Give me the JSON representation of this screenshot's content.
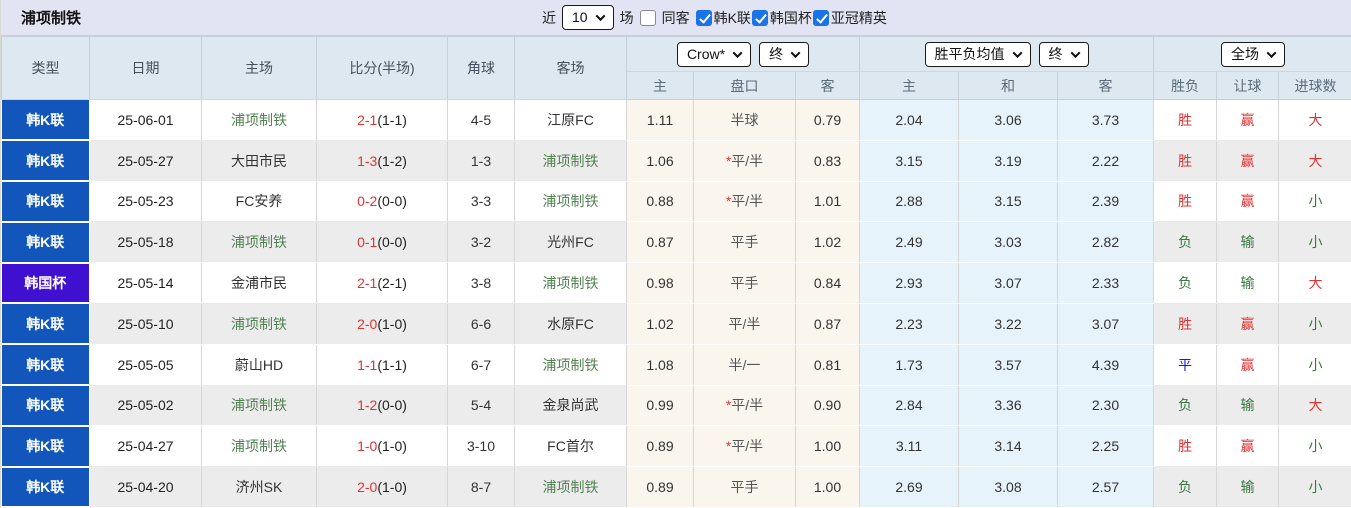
{
  "title": "浦项制铁",
  "toolbar": {
    "recent_label": "近",
    "recent_value": "10",
    "matches_label": "场",
    "same_away": {
      "label": "同客",
      "checked": false,
      "state_class": "unchecked"
    },
    "filters": [
      {
        "label": "韩K联",
        "checked": true,
        "state_class": "checked"
      },
      {
        "label": "韩国杯",
        "checked": true,
        "state_class": "checked"
      },
      {
        "label": "亚冠精英",
        "checked": true,
        "state_class": "checked"
      }
    ]
  },
  "table": {
    "main_headers": [
      "类型",
      "日期",
      "主场",
      "比分(半场)",
      "角球",
      "客场"
    ],
    "odds_group": {
      "bookmaker_select": "Crow*",
      "time_select": "终",
      "cols": [
        "主",
        "盘口",
        "客"
      ]
    },
    "avg_group": {
      "name_select": "胜平负均值",
      "time_select": "终",
      "cols": [
        "主",
        "和",
        "客"
      ]
    },
    "result_group": {
      "scope_select": "全场",
      "cols": [
        "胜负",
        "让球",
        "进球数"
      ]
    },
    "rows": [
      {
        "type": "韩K联",
        "type_class": "league",
        "date": "25-06-01",
        "home": "浦项制铁",
        "home_class": "team-green",
        "score_ft": "2-1",
        "score_ht": "(1-1)",
        "corner": "4-5",
        "away": "江原FC",
        "away_class": "plain",
        "odds_home": "1.11",
        "star": "",
        "handicap": "半球",
        "odds_away": "0.79",
        "avg_home": "2.04",
        "avg_draw": "3.06",
        "avg_away": "3.73",
        "wl": "胜",
        "wl_class": "red",
        "let": "赢",
        "let_class": "red",
        "goal": "大",
        "goal_class": "red"
      },
      {
        "type": "韩K联",
        "type_class": "league",
        "date": "25-05-27",
        "home": "大田市民",
        "home_class": "plain",
        "score_ft": "1-3",
        "score_ht": "(1-2)",
        "corner": "1-3",
        "away": "浦项制铁",
        "away_class": "team-green",
        "odds_home": "1.06",
        "star": "*",
        "handicap": "平/半",
        "odds_away": "0.83",
        "avg_home": "3.15",
        "avg_draw": "3.19",
        "avg_away": "2.22",
        "wl": "胜",
        "wl_class": "red",
        "let": "赢",
        "let_class": "red",
        "goal": "大",
        "goal_class": "red"
      },
      {
        "type": "韩K联",
        "type_class": "league",
        "date": "25-05-23",
        "home": "FC安养",
        "home_class": "plain",
        "score_ft": "0-2",
        "score_ht": "(0-0)",
        "corner": "3-3",
        "away": "浦项制铁",
        "away_class": "team-green",
        "odds_home": "0.88",
        "star": "*",
        "handicap": "平/半",
        "odds_away": "1.01",
        "avg_home": "2.88",
        "avg_draw": "3.15",
        "avg_away": "2.39",
        "wl": "胜",
        "wl_class": "red",
        "let": "赢",
        "let_class": "red",
        "goal": "小",
        "goal_class": "green"
      },
      {
        "type": "韩K联",
        "type_class": "league",
        "date": "25-05-18",
        "home": "浦项制铁",
        "home_class": "team-green",
        "score_ft": "0-1",
        "score_ht": "(0-0)",
        "corner": "3-2",
        "away": "光州FC",
        "away_class": "plain",
        "odds_home": "0.87",
        "star": "",
        "handicap": "平手",
        "odds_away": "1.02",
        "avg_home": "2.49",
        "avg_draw": "3.03",
        "avg_away": "2.82",
        "wl": "负",
        "wl_class": "green",
        "let": "输",
        "let_class": "green",
        "goal": "小",
        "goal_class": "green"
      },
      {
        "type": "韩国杯",
        "type_class": "cup",
        "date": "25-05-14",
        "home": "金浦市民",
        "home_class": "plain",
        "score_ft": "2-1",
        "score_ht": "(2-1)",
        "corner": "3-8",
        "away": "浦项制铁",
        "away_class": "team-green",
        "odds_home": "0.98",
        "star": "",
        "handicap": "平手",
        "odds_away": "0.84",
        "avg_home": "2.93",
        "avg_draw": "3.07",
        "avg_away": "2.33",
        "wl": "负",
        "wl_class": "green",
        "let": "输",
        "let_class": "green",
        "goal": "大",
        "goal_class": "red"
      },
      {
        "type": "韩K联",
        "type_class": "league",
        "date": "25-05-10",
        "home": "浦项制铁",
        "home_class": "team-green",
        "score_ft": "2-0",
        "score_ht": "(1-0)",
        "corner": "6-6",
        "away": "水原FC",
        "away_class": "plain",
        "odds_home": "1.02",
        "star": "",
        "handicap": "平/半",
        "odds_away": "0.87",
        "avg_home": "2.23",
        "avg_draw": "3.22",
        "avg_away": "3.07",
        "wl": "胜",
        "wl_class": "red",
        "let": "赢",
        "let_class": "red",
        "goal": "小",
        "goal_class": "green"
      },
      {
        "type": "韩K联",
        "type_class": "league",
        "date": "25-05-05",
        "home": "蔚山HD",
        "home_class": "plain",
        "score_ft": "1-1",
        "score_ht": "(1-1)",
        "corner": "6-7",
        "away": "浦项制铁",
        "away_class": "team-green",
        "odds_home": "1.08",
        "star": "",
        "handicap": "半/一",
        "odds_away": "0.81",
        "avg_home": "1.73",
        "avg_draw": "3.57",
        "avg_away": "4.39",
        "wl": "平",
        "wl_class": "blue",
        "let": "赢",
        "let_class": "red",
        "goal": "小",
        "goal_class": "green"
      },
      {
        "type": "韩K联",
        "type_class": "league",
        "date": "25-05-02",
        "home": "浦项制铁",
        "home_class": "team-green",
        "score_ft": "1-2",
        "score_ht": "(0-0)",
        "corner": "5-4",
        "away": "金泉尚武",
        "away_class": "plain",
        "odds_home": "0.99",
        "star": "*",
        "handicap": "平/半",
        "odds_away": "0.90",
        "avg_home": "2.84",
        "avg_draw": "3.36",
        "avg_away": "2.30",
        "wl": "负",
        "wl_class": "green",
        "let": "输",
        "let_class": "green",
        "goal": "大",
        "goal_class": "red"
      },
      {
        "type": "韩K联",
        "type_class": "league",
        "date": "25-04-27",
        "home": "浦项制铁",
        "home_class": "team-green",
        "score_ft": "1-0",
        "score_ht": "(1-0)",
        "corner": "3-10",
        "away": "FC首尔",
        "away_class": "plain",
        "odds_home": "0.89",
        "star": "*",
        "handicap": "平/半",
        "odds_away": "1.00",
        "avg_home": "3.11",
        "avg_draw": "3.14",
        "avg_away": "2.25",
        "wl": "胜",
        "wl_class": "red",
        "let": "赢",
        "let_class": "red",
        "goal": "小",
        "goal_class": "green"
      },
      {
        "type": "韩K联",
        "type_class": "league",
        "date": "25-04-20",
        "home": "济州SK",
        "home_class": "plain",
        "score_ft": "2-0",
        "score_ht": "(1-0)",
        "corner": "8-7",
        "away": "浦项制铁",
        "away_class": "team-green",
        "odds_home": "0.89",
        "star": "",
        "handicap": "平手",
        "odds_away": "1.00",
        "avg_home": "2.69",
        "avg_draw": "3.08",
        "avg_away": "2.57",
        "wl": "负",
        "wl_class": "green",
        "let": "输",
        "let_class": "green",
        "goal": "小",
        "goal_class": "green"
      }
    ]
  },
  "colors": {
    "league_blue": "#1356bb",
    "cup_purple": "#4010d0",
    "team_green": "#538253",
    "win_red": "#e23333",
    "lose_green": "#36793f",
    "draw_blue": "#1a16e0",
    "odds_cream_bg": "#faf6ed",
    "avg_blue_bg": "#e7f3fa",
    "header_bg": "#dee8f1",
    "topbar_bg": "#e3e4f3",
    "checkbox_blue": "#1a73e8"
  }
}
